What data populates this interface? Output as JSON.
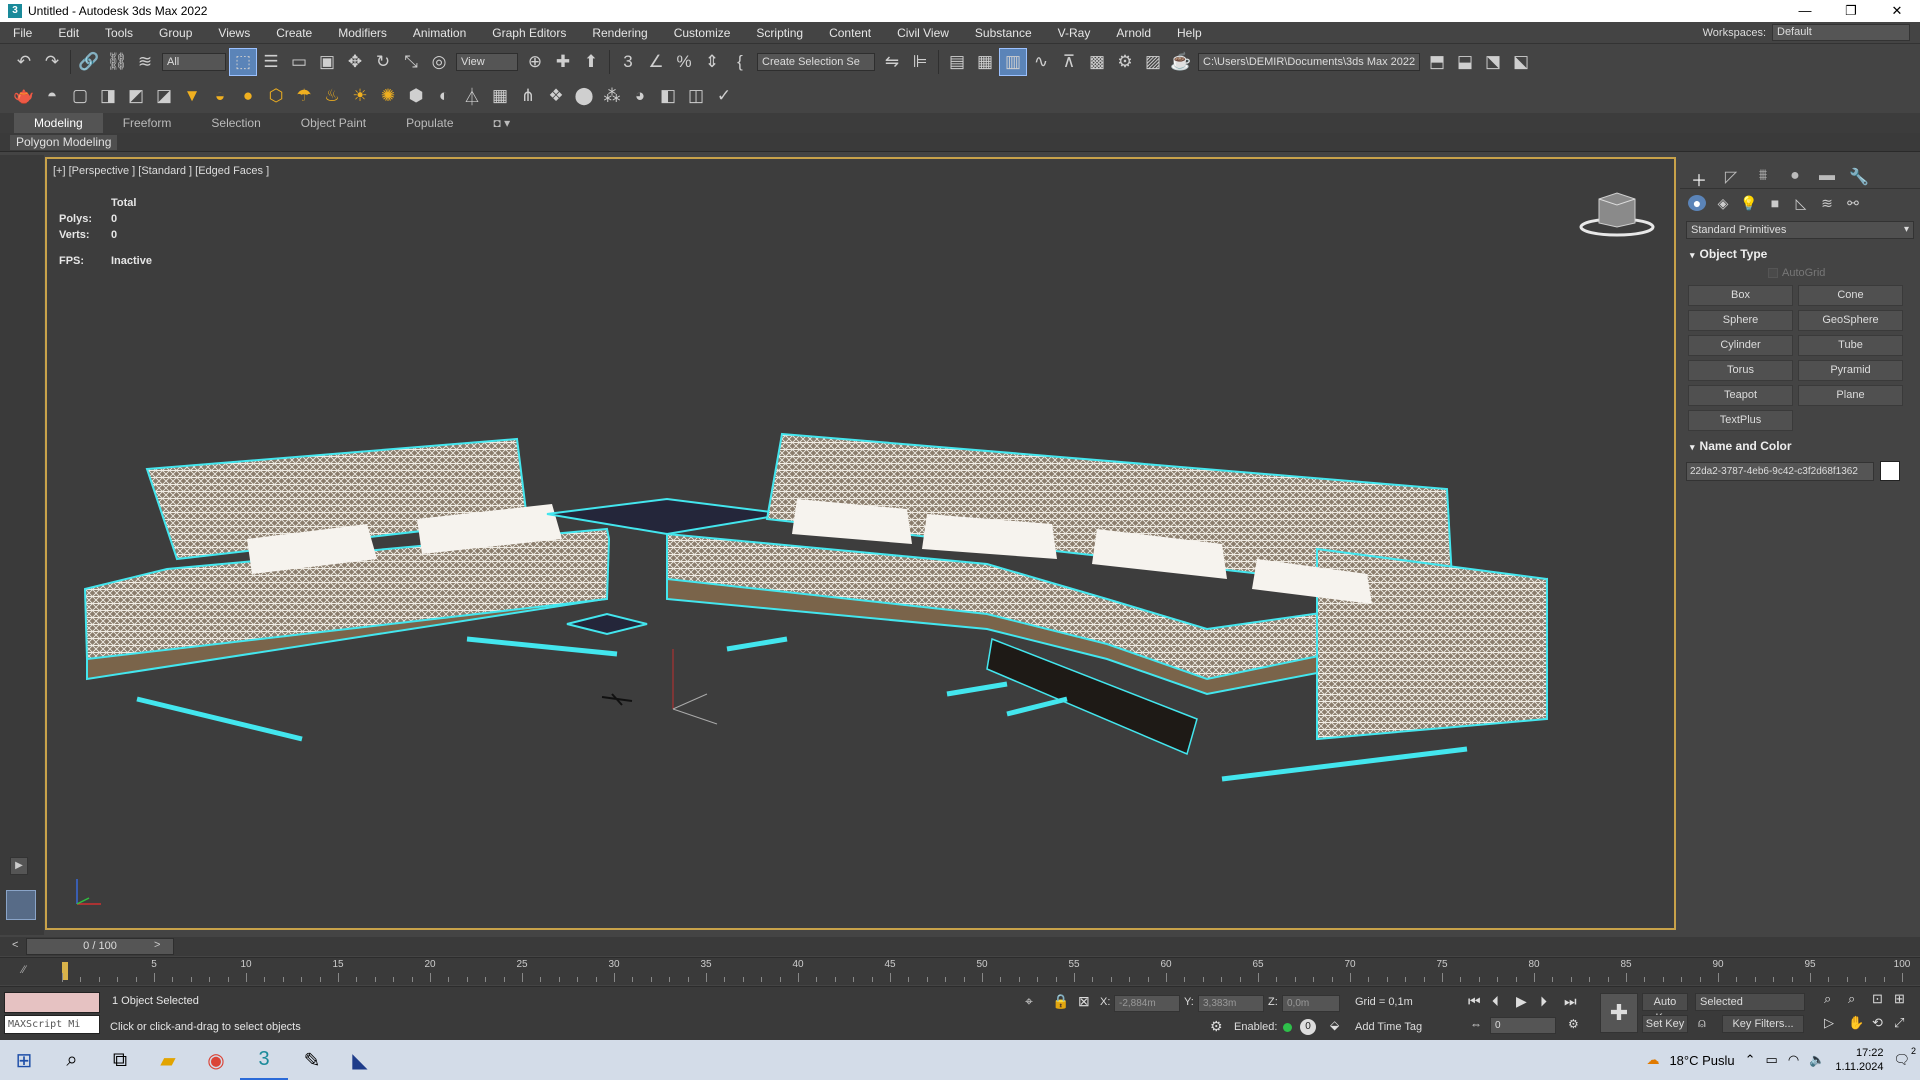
{
  "title": "Untitled - Autodesk 3ds Max 2022",
  "window_controls": {
    "minimize": "—",
    "restore": "❐",
    "close": "✕"
  },
  "menu": [
    "File",
    "Edit",
    "Tools",
    "Group",
    "Views",
    "Create",
    "Modifiers",
    "Animation",
    "Graph Editors",
    "Rendering",
    "Customize",
    "Scripting",
    "Content",
    "Civil View",
    "Substance",
    "V-Ray",
    "Arnold",
    "Help"
  ],
  "workspaces": {
    "label": "Workspaces:",
    "value": "Default"
  },
  "toolbar": {
    "filter_value": "All",
    "view_value": "View",
    "selection_set": "Create Selection Se",
    "project_path": "C:\\Users\\DEMIR\\Documents\\3ds Max 2022"
  },
  "ribbon": {
    "tabs": [
      "Modeling",
      "Freeform",
      "Selection",
      "Object Paint",
      "Populate"
    ],
    "panel": "Polygon Modeling"
  },
  "viewport": {
    "label": "[+] [Perspective ] [Standard ] [Edged Faces ]",
    "stats_total": "Total",
    "polys_label": "Polys:",
    "polys_value": "0",
    "verts_label": "Verts:",
    "verts_value": "0",
    "fps_label": "FPS:",
    "fps_value": "Inactive"
  },
  "command_panel": {
    "category": "Standard Primitives",
    "object_type_title": "Object Type",
    "autogrid": "AutoGrid",
    "buttons": [
      "Box",
      "Cone",
      "Sphere",
      "GeoSphere",
      "Cylinder",
      "Tube",
      "Torus",
      "Pyramid",
      "Teapot",
      "Plane",
      "TextPlus"
    ],
    "name_color_title": "Name and Color",
    "object_name": "22da2-3787-4eb6-9c42-c3f2d68f1362",
    "object_color": "#ffffff"
  },
  "timeline": {
    "frame": "0 / 100",
    "prev": "<",
    "next": ">",
    "ticks": [
      "5",
      "10",
      "15",
      "20",
      "25",
      "30",
      "35",
      "40",
      "45",
      "50",
      "55",
      "60",
      "65",
      "70",
      "75",
      "80",
      "85",
      "90",
      "95",
      "100"
    ]
  },
  "status": {
    "maxscript_placeholder": "MAXScript Mi",
    "selected": "1 Object Selected",
    "prompt": "Click or click-and-drag to select objects",
    "x_label": "X:",
    "x_value": "-2,884m",
    "y_label": "Y:",
    "y_value": "3,383m",
    "z_label": "Z:",
    "z_value": "0,0m",
    "grid": "Grid = 0,1m",
    "enabled": "Enabled:",
    "add_time_tag": "Add Time Tag",
    "auto_key": "Auto Key",
    "set_key": "Set Key",
    "selected_dropdown": "Selected",
    "key_filters": "Key Filters...",
    "frame_field": "0"
  },
  "taskbar": {
    "weather": "18°C  Puslu",
    "time": "17:22",
    "date": "1.11.2024",
    "notifications": "2"
  },
  "colors": {
    "selection_outline": "#43e6ee",
    "viewport_border": "#c8a24a",
    "accent": "#5b84b8"
  }
}
